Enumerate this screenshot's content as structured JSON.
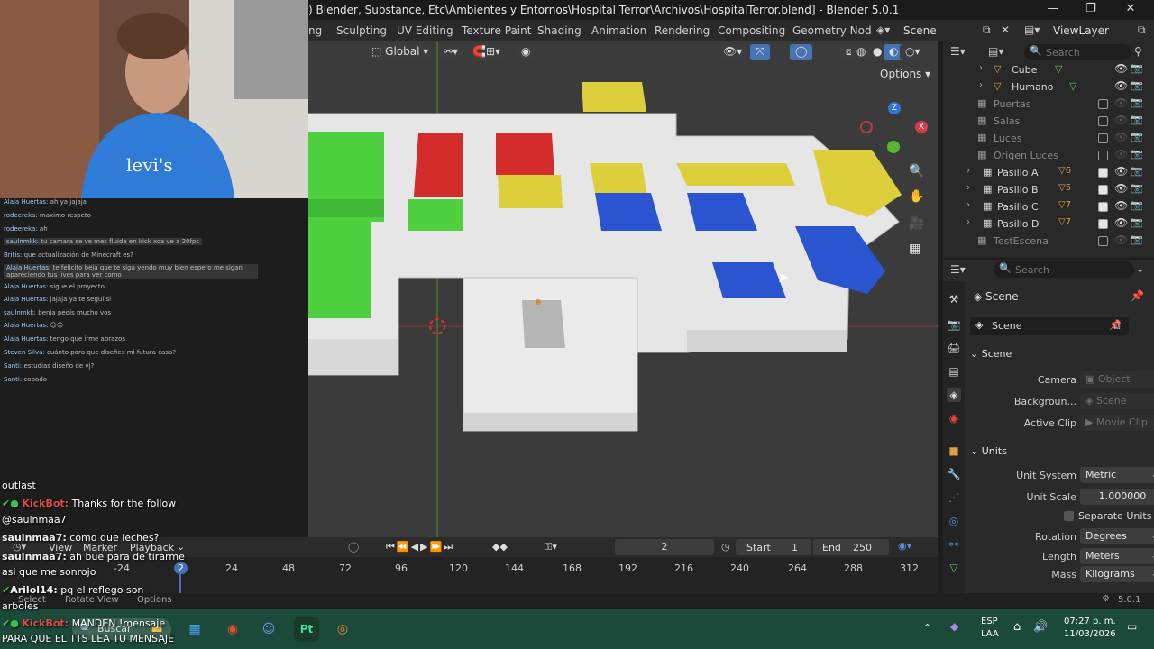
{
  "window": {
    "title": ") Blender, Substance, Etc\\Ambientes y Entornos\\Hospital Terror\\Archivos\\HospitalTerror.blend] - Blender 5.0.1",
    "min": "—",
    "max": "❐",
    "close": "✕"
  },
  "workspaces": [
    "ng",
    "Sculpting",
    "UV Editing",
    "Texture Paint",
    "Shading",
    "Animation",
    "Rendering",
    "Compositing",
    "Geometry Node"
  ],
  "scene_selector": "Scene",
  "view_layer": "ViewLayer",
  "viewport": {
    "orientation": "Global",
    "options": "Options",
    "axis": {
      "x": "X",
      "y": "Y",
      "z": "Z"
    }
  },
  "outliner": {
    "search_placeholder": "Search",
    "items": [
      {
        "label": "Cube",
        "type": "object",
        "expanded": false
      },
      {
        "label": "Humano",
        "type": "object",
        "expanded": false
      },
      {
        "label": "Puertas",
        "type": "collection",
        "enabled": false
      },
      {
        "label": "Salas",
        "type": "collection",
        "enabled": false
      },
      {
        "label": "Luces",
        "type": "collection",
        "enabled": false
      },
      {
        "label": "Origen Luces",
        "type": "collection",
        "enabled": false
      },
      {
        "label": "Pasillo A",
        "type": "collection",
        "enabled": true,
        "sub": "6"
      },
      {
        "label": "Pasillo B",
        "type": "collection",
        "enabled": true,
        "sub": "5"
      },
      {
        "label": "Pasillo C",
        "type": "collection",
        "enabled": true,
        "sub": "7"
      },
      {
        "label": "Pasillo D",
        "type": "collection",
        "enabled": true,
        "sub": "7"
      },
      {
        "label": "TestEscena",
        "type": "collection",
        "enabled": false
      }
    ]
  },
  "properties": {
    "search_placeholder": "Search",
    "context": "Scene",
    "scene_name": "Scene",
    "scene_section": "Scene",
    "camera_label": "Camera",
    "camera_value": "Object",
    "background_label": "Backgroun...",
    "background_value": "Scene",
    "clip_label": "Active Clip",
    "clip_value": "Movie Clip",
    "units_section": "Units",
    "unit_system_label": "Unit System",
    "unit_system_value": "Metric",
    "unit_scale_label": "Unit Scale",
    "unit_scale_value": "1.000000",
    "separate_units": "Separate Units",
    "rotation_label": "Rotation",
    "rotation_value": "Degrees",
    "length_label": "Length",
    "length_value": "Meters",
    "mass_label": "Mass",
    "mass_value": "Kilograms"
  },
  "timeline": {
    "menus": [
      "View",
      "Marker",
      "Playback"
    ],
    "current_frame": "2",
    "start_label": "Start",
    "start_value": "1",
    "end_label": "End",
    "end_value": "250",
    "ticks": [
      "-24",
      "2",
      "24",
      "48",
      "72",
      "96",
      "120",
      "144",
      "168",
      "192",
      "216",
      "240",
      "264",
      "288",
      "312"
    ]
  },
  "statusbar": {
    "select": "Select",
    "rotate": "Rotate View",
    "options": "Options",
    "version": "5.0.1"
  },
  "taskbar": {
    "search": "Buscar",
    "lang": "ESP",
    "lang2": "LAA",
    "time": "07:27 p. m.",
    "date": "11/03/2026"
  },
  "chat_small": [
    {
      "user": "Alaja Huertas:",
      "msg": "ah ya jajaja"
    },
    {
      "user": "rodeereka:",
      "msg": "maximo respeto"
    },
    {
      "user": "rodeereka:",
      "msg": "ah"
    },
    {
      "user": "saulnmkk:",
      "msg": "tu camara se ve mes fluida en kick xca ve a 20fps"
    },
    {
      "user": "Britis:",
      "msg": "que actualización de Minecraft es?"
    },
    {
      "user": "Alaja Huertas:",
      "msg": "te felicito beja que te siga yendo muy bien espero me sigan apareciendo tus lives para ver como"
    },
    {
      "user": "Alaja Huertas:",
      "msg": "sigue el proyecto"
    },
    {
      "user": "Alaja Huertas:",
      "msg": "jajaja ya te seguí si"
    },
    {
      "user": "saulnmkk:",
      "msg": "benja pedís mucho vos"
    },
    {
      "user": "Alaja Huertas:",
      "msg": "😊😊"
    },
    {
      "user": "Alaja Huertas:",
      "msg": "tengo que irme abrazos"
    },
    {
      "user": "Steven Silva:",
      "msg": "cuánto para que diseñes mi futura casa?"
    },
    {
      "user": "Santi:",
      "msg": "estudias diseño de vj?"
    },
    {
      "user": "Santi:",
      "msg": "copado"
    }
  ],
  "chat_big": [
    {
      "user": "",
      "msg": "outlast"
    },
    {
      "user": "KickBot:",
      "msg": "Thanks for the follow",
      "bot": true
    },
    {
      "user": "",
      "msg": "@saulnmaa7"
    },
    {
      "user": "saulnmaa7:",
      "msg": "como que leches?"
    },
    {
      "user": "saulnmaa7:",
      "msg": "ah bue para de tirarme"
    },
    {
      "user": "",
      "msg": "asi que me sonrojo"
    },
    {
      "user": "Arilol14:",
      "msg": "pq el reflego son"
    },
    {
      "user": "",
      "msg": "arboles"
    },
    {
      "user": "KickBot:",
      "msg": "MANDEN !mensaje",
      "bot": true
    },
    {
      "user": "",
      "msg": "PARA QUE EL TTS LEA TU MENSAJE"
    }
  ],
  "colors": {
    "green": "#4ccd3d",
    "red": "#d32a2a",
    "yellow": "#d9cd3c",
    "blue": "#2a52cc",
    "floor": "#e4e4e4"
  }
}
